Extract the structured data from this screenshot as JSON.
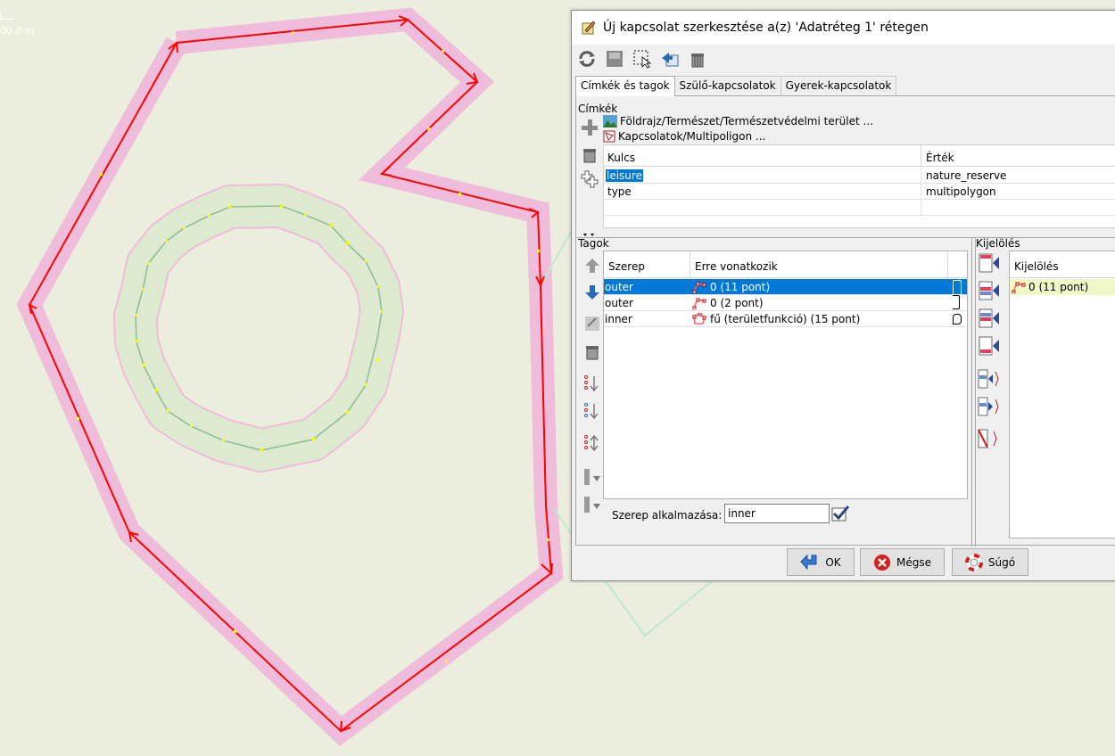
{
  "map": {
    "scale_label": "00.0 m"
  },
  "dialog": {
    "title": "Új kapcsolat szerkesztése a(z) 'Adatréteg 1' rétegen",
    "toolbar": {
      "icons": [
        "refresh-icon",
        "save-icon",
        "select-icon",
        "zoom-icon",
        "delete-icon"
      ]
    },
    "tabs": [
      "Címkék és tagok",
      "Szülő-kapcsolatok",
      "Gyerek-kapcsolatok"
    ],
    "tags_section": {
      "label": "Címkék",
      "presets": [
        "Földrajz/Természet/Természetvédelmi terület ...",
        "Kapcsolatok/Multipoligon ..."
      ],
      "columns": [
        "Kulcs",
        "Érték"
      ],
      "rows": [
        {
          "key": "leisure",
          "value": "nature_reserve"
        },
        {
          "key": "type",
          "value": "multipolygon"
        }
      ]
    },
    "members_section": {
      "label": "Tagok",
      "columns": [
        "Szerep",
        "Erre vonatkozik"
      ],
      "rows": [
        {
          "role": "outer",
          "refers": "0 (11 pont)"
        },
        {
          "role": "outer",
          "refers": "0 (2 pont)"
        },
        {
          "role": "inner",
          "refers": "fű (területfunkció) (15 pont)"
        }
      ],
      "apply_role_label": "Szerep alkalmazása:",
      "apply_role_value": "inner"
    },
    "selection_section": {
      "label": "Kijelölés",
      "column": "Kijelölés",
      "rows": [
        "0 (11 pont)"
      ]
    },
    "buttons": {
      "ok": "OK",
      "cancel": "Mégse",
      "help": "Súgó"
    }
  },
  "colors": {
    "map_bg": "#eceedd",
    "selection": "#0078d7",
    "way": "#ff0000",
    "area_fill": "#f0bcdc"
  }
}
